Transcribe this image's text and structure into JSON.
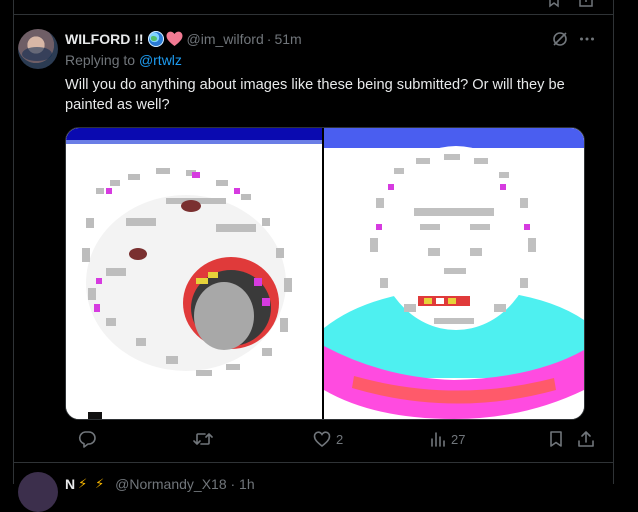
{
  "tweet": {
    "display_name": "WILFORD !!",
    "name_emoji": [
      "globe-with-meridians-emoji",
      "pink-heart-emoji"
    ],
    "handle": "@im_wilford",
    "separator": "·",
    "time": "51m",
    "replying_prefix": "Replying to",
    "replying_to": "@rtwlz",
    "text": "Will you do anything about images like these being submitted? Or will they be painted as well?",
    "media_count": 2,
    "actions": {
      "reply": {
        "icon": "reply-icon",
        "count": ""
      },
      "retweet": {
        "icon": "retweet-icon",
        "count": ""
      },
      "like": {
        "icon": "heart-icon",
        "count": "2"
      },
      "views": {
        "icon": "views-icon",
        "count": "27"
      },
      "bookmark": {
        "icon": "bookmark-icon"
      },
      "share": {
        "icon": "share-icon"
      }
    },
    "header_icons": [
      "grok-icon",
      "more-icon"
    ]
  },
  "next_tweet": {
    "display_name": "N",
    "name_emoji": [
      "lightning-emoji",
      "lightning-emoji"
    ],
    "handle_partial": "@Normandy_X18 · 1h"
  },
  "colors": {
    "background": "#000000",
    "divider": "#2f3336",
    "text_primary": "#e7e9ea",
    "text_secondary": "#71767b",
    "link": "#1d9bf0"
  }
}
